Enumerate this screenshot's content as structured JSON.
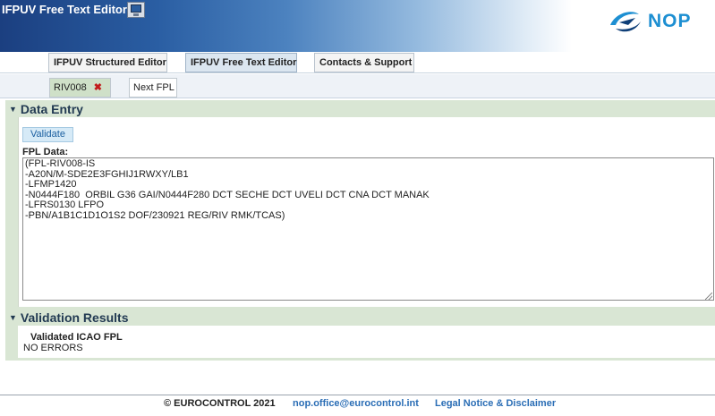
{
  "header": {
    "title": "IFPUV Free Text Editor",
    "brand": "NOP",
    "brand_color": "#1d8fd2"
  },
  "main_tabs": [
    {
      "label": "IFPUV Structured Editor",
      "active": false
    },
    {
      "label": "IFPUV Free Text Editor",
      "active": true
    },
    {
      "label": "Contacts & Support",
      "active": false
    }
  ],
  "fpl_tabs": [
    {
      "label": "RIV008",
      "active": true,
      "close_icon": "close-icon"
    },
    {
      "label": "Next FPL",
      "active": false
    }
  ],
  "data_entry": {
    "heading": "Data Entry",
    "validate_label": "Validate",
    "fpl_label": "FPL Data:",
    "fpl_text": "(FPL-RIV008-IS\n-A20N/M-SDE2E3FGHIJ1RWXY/LB1\n-LFMP1420\n-N0444F180  ORBIL G36 GAI/N0444F280 DCT SECHE DCT UVELI DCT CNA DCT MANAK\n-LFRS0130 LFPO\n-PBN/A1B1C1D1O1S2 DOF/230921 REG/RIV RMK/TCAS)"
  },
  "validation_results": {
    "heading": "Validation Results",
    "result_heading": "Validated ICAO FPL",
    "result_text": "NO ERRORS"
  },
  "footer": {
    "copyright": "© EUROCONTROL 2021",
    "email": "nop.office@eurocontrol.int",
    "legal": "Legal Notice & Disclaimer"
  }
}
